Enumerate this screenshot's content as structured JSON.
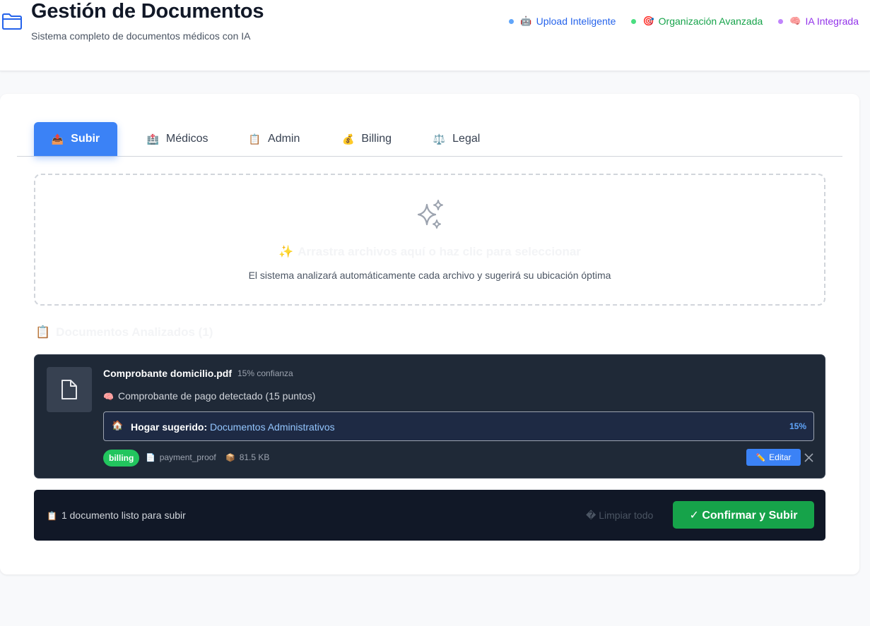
{
  "header": {
    "title": "Gestión de Documentos",
    "subtitle": "Sistema completo de documentos médicos con IA",
    "features": [
      {
        "icon": "🤖",
        "label": "Upload Inteligente",
        "color": "#2563eb",
        "dot": "#60a5fa"
      },
      {
        "icon": "🎯",
        "label": "Organización Avanzada",
        "color": "#16a34a",
        "dot": "#4ade80"
      },
      {
        "icon": "🧠",
        "label": "IA Integrada",
        "color": "#9333ea",
        "dot": "#c084fc"
      }
    ]
  },
  "tabs": [
    {
      "icon": "📤",
      "label": "Subir"
    },
    {
      "icon": "🏥",
      "label": "Médicos"
    },
    {
      "icon": "📋",
      "label": "Admin"
    },
    {
      "icon": "💰",
      "label": "Billing"
    },
    {
      "icon": "⚖️",
      "label": "Legal"
    }
  ],
  "dropzone": {
    "icon": "✨",
    "title": "Arrastra archivos aquí o haz clic para seleccionar",
    "subtitle": "El sistema analizará automáticamente cada archivo y sugerirá su ubicación óptima"
  },
  "analyzed": {
    "icon": "📋",
    "title": "Documentos Analizados (1)"
  },
  "document": {
    "name": "Comprobante domicilio.pdf",
    "confidence": "15% confianza",
    "detection_icon": "🧠",
    "detection": "Comprobante de pago detectado (15 puntos)",
    "home_icon": "🏠",
    "home_label": "Hogar sugerido:",
    "home_value": "Documentos Administrativos",
    "home_pct": "15%",
    "tag": "billing",
    "type_icon": "📄",
    "type": "payment_proof",
    "size_icon": "📦",
    "size": "81.5 KB",
    "edit_icon": "✏️",
    "edit_label": "Editar"
  },
  "footer": {
    "ready_icon": "📋",
    "ready_text": "1 documento listo para subir",
    "clear_label": "� Limpiar todo",
    "confirm_label": "✓ Confirmar y Subir"
  },
  "colors": {
    "accent": "#3b82f6",
    "success": "#16a34a",
    "dark_panel": "#1f2937",
    "dark_footer": "#111827"
  }
}
